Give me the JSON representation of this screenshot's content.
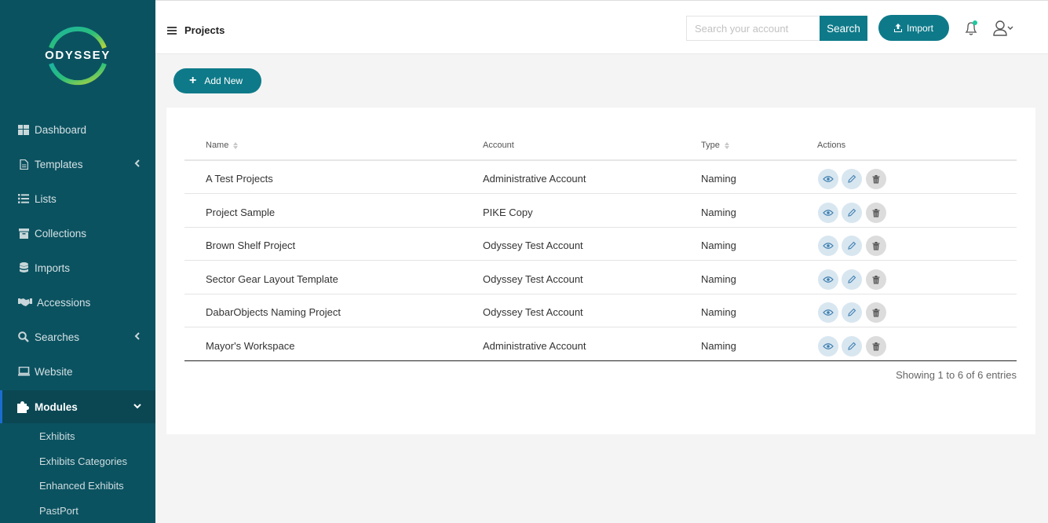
{
  "brand": {
    "name": "ODYSSEY"
  },
  "sidebar": {
    "items": [
      {
        "label": "Dashboard",
        "icon": "dashboard-icon"
      },
      {
        "label": "Templates",
        "icon": "file-icon"
      },
      {
        "label": "Lists",
        "icon": "list-icon"
      },
      {
        "label": "Collections",
        "icon": "archive-icon"
      },
      {
        "label": "Imports",
        "icon": "database-icon"
      },
      {
        "label": "Accessions",
        "icon": "handshake-icon"
      },
      {
        "label": "Searches",
        "icon": "search-icon"
      },
      {
        "label": "Website",
        "icon": "laptop-icon"
      },
      {
        "label": "Modules",
        "icon": "puzzle-icon"
      }
    ],
    "submenu": [
      "Exhibits",
      "Exhibits Categories",
      "Enhanced Exhibits",
      "PastPort"
    ]
  },
  "header": {
    "title": "Projects",
    "search_placeholder": "Search your account",
    "search_label": "Search",
    "import_label": "Import"
  },
  "toolbar": {
    "add_label": "Add New"
  },
  "table": {
    "columns": [
      "Name",
      "Account",
      "Type",
      "Actions"
    ],
    "rows": [
      {
        "name": "A Test Projects",
        "account": "Administrative Account",
        "type": "Naming"
      },
      {
        "name": "Project Sample",
        "account": "PIKE Copy",
        "type": "Naming"
      },
      {
        "name": "Brown Shelf Project",
        "account": "Odyssey Test Account",
        "type": "Naming"
      },
      {
        "name": "Sector Gear Layout Template",
        "account": "Odyssey Test Account",
        "type": "Naming"
      },
      {
        "name": "DabarObjects Naming Project",
        "account": "Odyssey Test Account",
        "type": "Naming"
      },
      {
        "name": "Mayor's Workspace",
        "account": "Administrative Account",
        "type": "Naming"
      }
    ],
    "info": "Showing 1 to 6 of 6 entries"
  },
  "colors": {
    "sidebar": "#0b5260",
    "accent": "#0e7a89",
    "active_border": "#1a6dd0",
    "notification_dot": "#1ec8a0"
  }
}
